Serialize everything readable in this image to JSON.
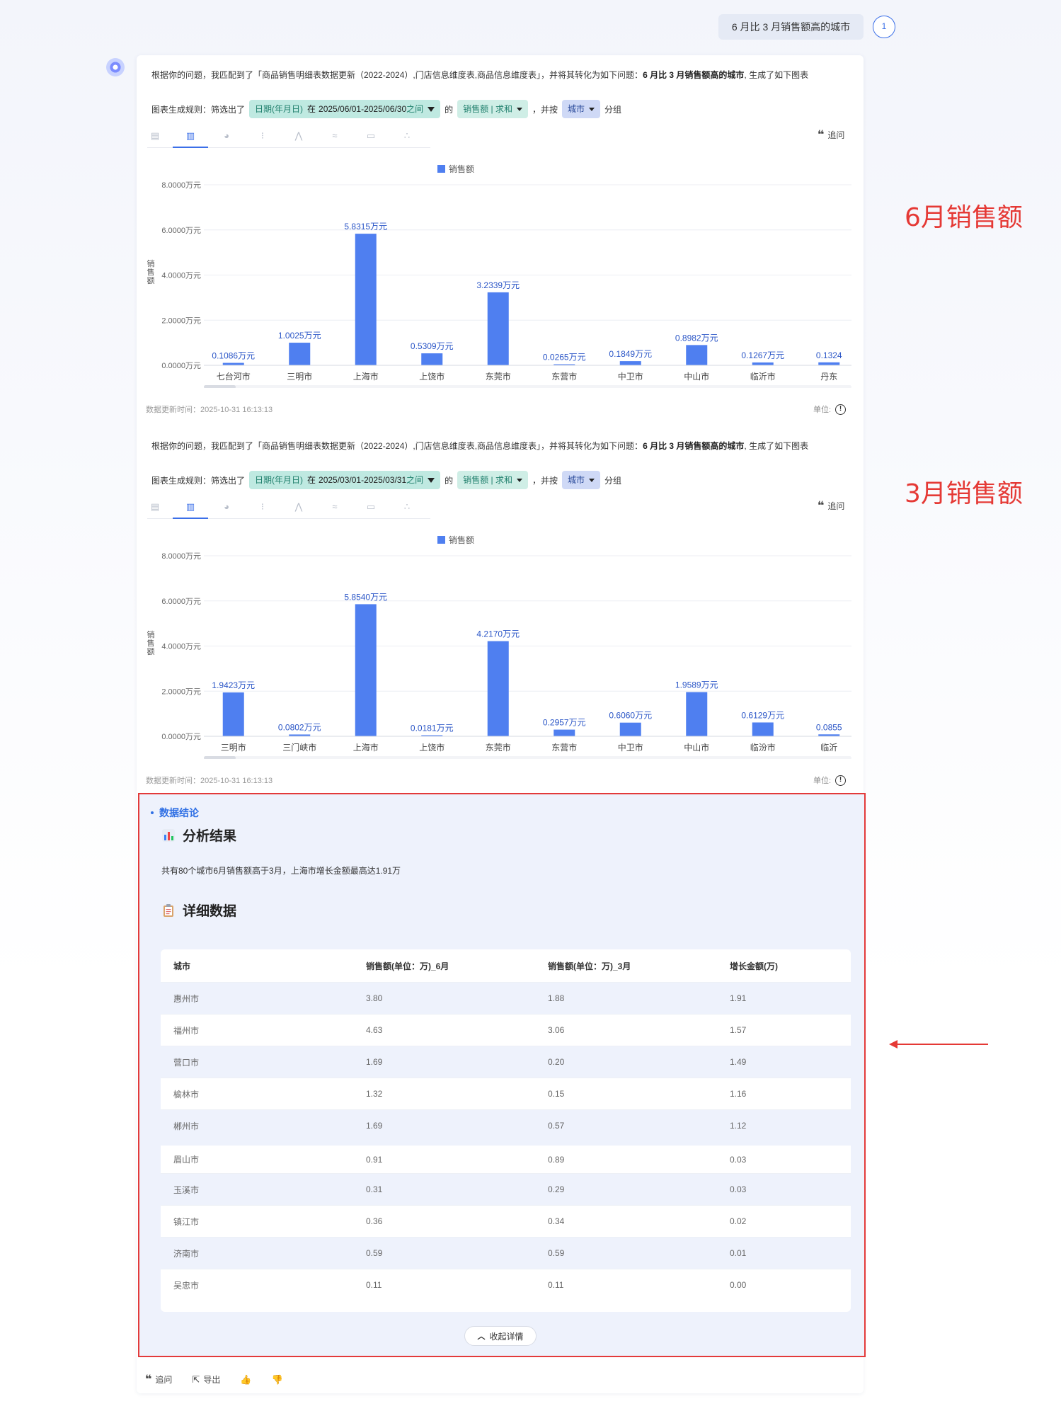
{
  "question": {
    "text": "6 月比 3 月销售额高的城市",
    "user_badge": "1"
  },
  "blocks": [
    {
      "intro_prefix": "根据你的问题，我匹配到了「商品销售明细表数据更新（2022-2024）,门店信息维度表,商品信息维度表」，并将其转化为如下问题：",
      "intro_bold": "6 月比 3 月销售额高的城市",
      "intro_suffix": ", 生成了如下图表",
      "rule_label": "图表生成规则：筛选出了",
      "date_filter_field": "日期(年月日)",
      "date_filter_op": "在",
      "date_filter_value": "2025/06/01-2025/06/30",
      "date_filter_suffix": "之间",
      "of": "的",
      "measure": "销售额 | 求和",
      "group_prefix": "，并按",
      "group_field": "城市",
      "group_suffix": "分组",
      "ask_label": "追问",
      "update_time": "数据更新时间：2025-10-31 16:13:13",
      "unit_label": "单位:"
    },
    {
      "intro_prefix": "根据你的问题，我匹配到了「商品销售明细表数据更新（2022-2024）,门店信息维度表,商品信息维度表」，并将其转化为如下问题：",
      "intro_bold": "6 月比 3 月销售额高的城市",
      "intro_suffix": ", 生成了如下图表",
      "rule_label": "图表生成规则：筛选出了",
      "date_filter_field": "日期(年月日)",
      "date_filter_op": "在",
      "date_filter_value": "2025/03/01-2025/03/31",
      "date_filter_suffix": "之间",
      "of": "的",
      "measure": "销售额 | 求和",
      "group_prefix": "，并按",
      "group_field": "城市",
      "group_suffix": "分组",
      "ask_label": "追问",
      "update_time": "数据更新时间：2025-10-31 16:13:13",
      "unit_label": "单位:"
    }
  ],
  "chart_data": [
    {
      "type": "bar",
      "legend": "销售额",
      "ylabel": "销售额",
      "ylim": [
        0,
        8
      ],
      "yticks": [
        "0.0000万元",
        "2.0000万元",
        "4.0000万元",
        "6.0000万元",
        "8.0000万元"
      ],
      "categories": [
        "七台河市",
        "三明市",
        "上海市",
        "上饶市",
        "东莞市",
        "东营市",
        "中卫市",
        "中山市",
        "临沂市",
        "丹东"
      ],
      "values": [
        0.1086,
        1.0025,
        5.8315,
        0.5309,
        3.2339,
        0.0265,
        0.1849,
        0.8982,
        0.1267,
        0.1324
      ],
      "labels": [
        "0.1086万元",
        "1.0025万元",
        "5.8315万元",
        "0.5309万元",
        "3.2339万元",
        "0.0265万元",
        "0.1849万元",
        "0.8982万元",
        "0.1267万元",
        "0.1324"
      ],
      "grid": true,
      "legend_position": "top-center"
    },
    {
      "type": "bar",
      "legend": "销售额",
      "ylabel": "销售额",
      "ylim": [
        0,
        8
      ],
      "yticks": [
        "0.0000万元",
        "2.0000万元",
        "4.0000万元",
        "6.0000万元",
        "8.0000万元"
      ],
      "categories": [
        "三明市",
        "三门峡市",
        "上海市",
        "上饶市",
        "东莞市",
        "东营市",
        "中卫市",
        "中山市",
        "临汾市",
        "临沂"
      ],
      "values": [
        1.9423,
        0.0802,
        5.854,
        0.0181,
        4.217,
        0.2957,
        0.606,
        1.9589,
        0.6129,
        0.0855
      ],
      "labels": [
        "1.9423万元",
        "0.0802万元",
        "5.8540万元",
        "0.0181万元",
        "4.2170万元",
        "0.2957万元",
        "0.6060万元",
        "1.9589万元",
        "0.6129万元",
        "0.0855"
      ],
      "grid": true,
      "legend_position": "top-center"
    }
  ],
  "annotations": {
    "june": "6月销售额",
    "march": "3月销售额"
  },
  "conclusion": {
    "title": "数据结论",
    "analysis_heading": "分析结果",
    "summary": "共有80个城市6月销售额高于3月，上海市增长金额最高达1.91万",
    "detail_heading": "详细数据",
    "columns": [
      "城市",
      "销售额(单位：万)_6月",
      "销售额(单位：万)_3月",
      "增长金额(万)"
    ],
    "rows": [
      [
        "惠州市",
        "3.80",
        "1.88",
        "1.91"
      ],
      [
        "福州市",
        "4.63",
        "3.06",
        "1.57"
      ],
      [
        "营口市",
        "1.69",
        "0.20",
        "1.49"
      ],
      [
        "榆林市",
        "1.32",
        "0.15",
        "1.16"
      ],
      [
        "郴州市",
        "1.69",
        "0.57",
        "1.12"
      ],
      [
        "眉山市",
        "0.91",
        "0.89",
        "0.03"
      ],
      [
        "玉溪市",
        "0.31",
        "0.29",
        "0.03"
      ],
      [
        "镇江市",
        "0.36",
        "0.34",
        "0.02"
      ],
      [
        "济南市",
        "0.59",
        "0.59",
        "0.01"
      ],
      [
        "吴忠市",
        "0.11",
        "0.11",
        "0.00"
      ]
    ],
    "collapse_label": "收起详情"
  },
  "footer": {
    "ask": "追问",
    "export": "导出"
  }
}
